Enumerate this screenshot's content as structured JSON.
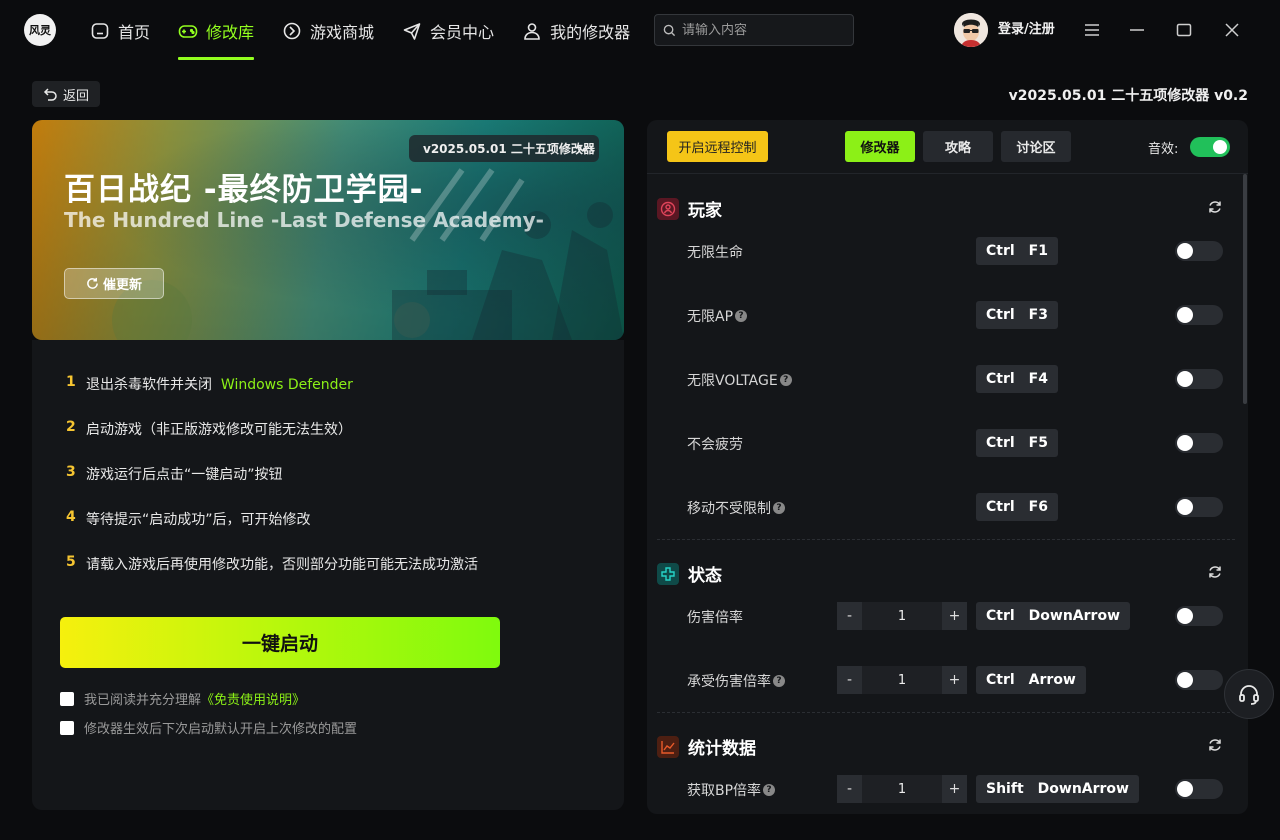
{
  "header": {
    "logo_text": "风灵",
    "nav": [
      {
        "label": "首页",
        "icon": "home-icon"
      },
      {
        "label": "修改库",
        "icon": "gamepad-icon"
      },
      {
        "label": "游戏商城",
        "icon": "store-icon"
      },
      {
        "label": "会员中心",
        "icon": "send-icon"
      },
      {
        "label": "我的修改器",
        "icon": "user-icon"
      }
    ],
    "search_placeholder": "请输入内容",
    "login_label": "登录/注册"
  },
  "back_label": "返回",
  "version_title": "v2025.05.01 二十五项修改器 v0.2",
  "banner": {
    "title": "百日战纪 -最终防卫学园-",
    "subtitle": "The Hundred Line -Last Defense Academy-",
    "update_label": "催更新",
    "version_select": "v2025.05.01 二十五项修改器 v0.2"
  },
  "steps": [
    {
      "num": "1",
      "text": "退出杀毒软件并关闭",
      "highlight": "Windows Defender"
    },
    {
      "num": "2",
      "text": "启动游戏（非正版游戏修改可能无法生效）",
      "highlight": ""
    },
    {
      "num": "3",
      "text": "游戏运行后点击“一键启动”按钮",
      "highlight": ""
    },
    {
      "num": "4",
      "text": "等待提示“启动成功”后，可开始修改",
      "highlight": ""
    },
    {
      "num": "5",
      "text": "请载入游戏后再使用修改功能，否则部分功能可能无法成功激活",
      "highlight": ""
    }
  ],
  "launch_label": "一键启动",
  "checks": [
    {
      "text": "我已阅读并充分理解",
      "link": "《免责使用说明》"
    },
    {
      "text": "修改器生效后下次启动默认开启上次修改的配置",
      "link": ""
    }
  ],
  "right_panel": {
    "remote_label": "开启远程控制",
    "tabs": [
      "修改器",
      "攻略",
      "讨论区"
    ],
    "active_tab": "修改器",
    "sound_label": "音效:",
    "sound_on": true,
    "sections": [
      {
        "title": "玩家",
        "icon": "player-icon",
        "color": "#e0445a",
        "rows": [
          {
            "label": "无限生命",
            "help": false,
            "keys": [
              "Ctrl",
              "F1"
            ],
            "on": false
          },
          {
            "label": "无限AP",
            "help": true,
            "keys": [
              "Ctrl",
              "F3"
            ],
            "on": false
          },
          {
            "label": "无限VOLTAGE",
            "help": true,
            "keys": [
              "Ctrl",
              "F4"
            ],
            "on": false
          },
          {
            "label": "不会疲劳",
            "help": false,
            "keys": [
              "Ctrl",
              "F5"
            ],
            "on": false
          },
          {
            "label": "移动不受限制",
            "help": true,
            "keys": [
              "Ctrl",
              "F6"
            ],
            "on": false
          }
        ]
      },
      {
        "title": "状态",
        "icon": "status-icon",
        "color": "#26d4c8",
        "rows": [
          {
            "label": "伤害倍率",
            "help": false,
            "value": "1",
            "keys": [
              "Ctrl",
              "DownArrow"
            ],
            "on": false
          },
          {
            "label": "承受伤害倍率",
            "help": true,
            "value": "1",
            "keys": [
              "Ctrl",
              "Arrow"
            ],
            "on": false
          }
        ]
      },
      {
        "title": "统计数据",
        "icon": "chart-icon",
        "color": "#e85a2a",
        "rows": [
          {
            "label": "获取BP倍率",
            "help": true,
            "value": "1",
            "keys": [
              "Shift",
              "DownArrow"
            ],
            "on": false
          }
        ]
      }
    ]
  }
}
